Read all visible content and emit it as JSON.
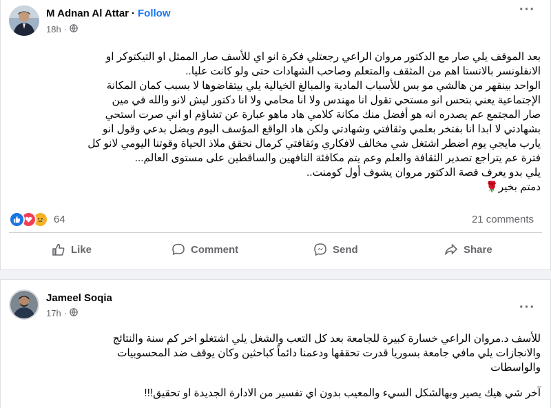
{
  "post": {
    "author": "M Adnan Al Attar",
    "follow_label": "Follow",
    "separator": "·",
    "time": "18h",
    "privacy_icon": "globe-icon",
    "text_lines": [
      "بعد الموقف يلي صار مع الدكتور مروان الراعي رجعتلي فكرة انو اي للأسف صار الممثل او التيكتوكر او",
      "الانفلونسر بالانستا اهم من المثقف والمتعلم وصاحب الشهادات حتى ولو كانت عليا..",
      "الواحد بينقهر من هالشي مو بس للأسباب المادية والمبالغ الخيالية يلي بيتقاضوها لا بسبب كمان المكانة",
      "الإجتماعية يعني بتحس انو مستحي تقول انا مهندس ولا انا محامي ولا انا دكتور ليش لانو والله في مين",
      "صار المجتمع عم يصدره انه هو أفضل منك مكانة كلامي هاد ماهو عبارة عن تشاؤم او اني صرت استحي",
      "بشهادتي لا ابدا انا بفتخر بعلمي وثقافتي وشهادتي ولكن هاد الواقع المؤسف اليوم وبضل بدعي وقول انو",
      "يارب مايجي يوم اضطر اشتغل شي مخالف لافكاري وثقافتي كرمال نحقق ملاذ الحياة وقوتنا اليومي لانو كل",
      "فترة عم يتراجع تصدير الثقافة  والعلم وعم يتم مكافئة التافهين والساقطين على مستوى العالم...",
      "يلي بدو يعرف قصة الدكتور مروان يشوف أول كومنت..",
      "دمتم بخير🌹"
    ],
    "reaction_count": "64",
    "comments_count": "21 comments",
    "actions": [
      {
        "label": "Like",
        "icon": "thumbs-up-icon"
      },
      {
        "label": "Comment",
        "icon": "comment-bubble-icon"
      },
      {
        "label": "Send",
        "icon": "messenger-icon"
      },
      {
        "label": "Share",
        "icon": "share-arrow-icon"
      }
    ]
  },
  "comment": {
    "author": "Jameel Soqia",
    "separator": "·",
    "time": "17h",
    "privacy_icon": "globe-icon",
    "paragraph1_lines": [
      "للأسف د.مروان الراعي خسارة كبيرة للجامعة بعد كل التعب والشغل يلي اشتغلو اخر كم سنة والنتائج",
      "والانجازات يلي مافي جامعة بسوريا قدرت تحققها ودعمنا دائماً كباحثين وكان يوقف ضد المحسوبيات",
      "والواسطات"
    ],
    "paragraph2_lines": [
      "آخر شي هيك يصير وبهالشكل السيء والمعيب بدون اي تفسير من الادارة الجديدة او تحقيق!!!"
    ]
  },
  "colors": {
    "accent": "#1877f2",
    "secondary_text": "#65676b",
    "background": "#f0f2f5"
  }
}
